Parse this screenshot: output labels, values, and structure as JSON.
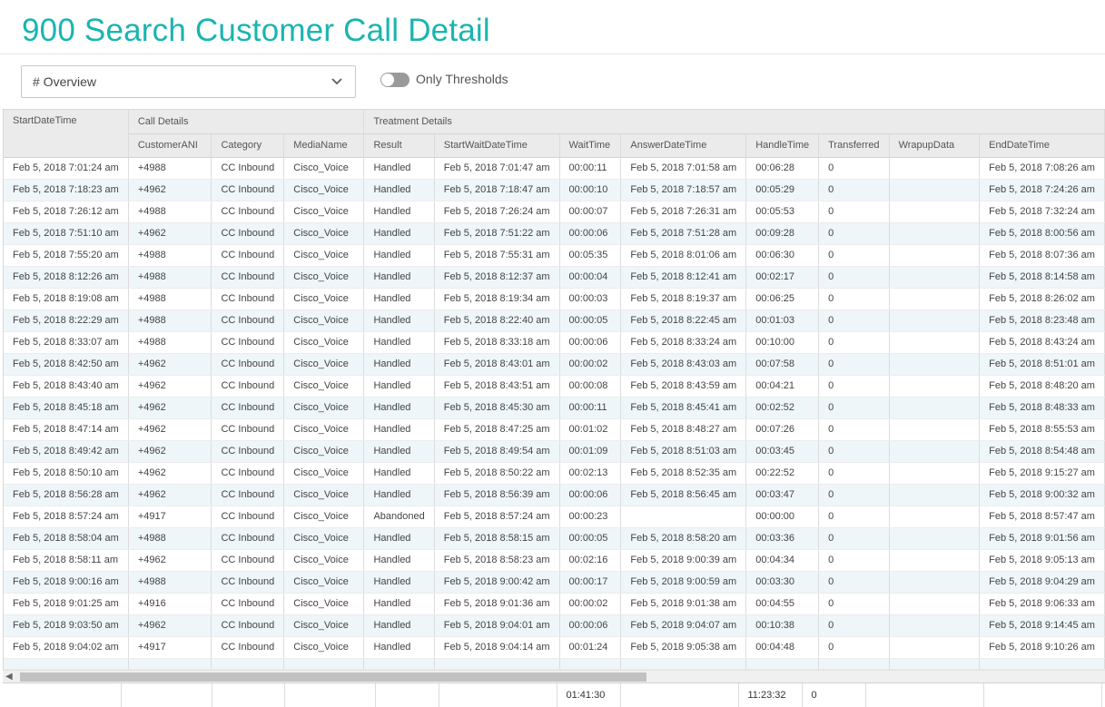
{
  "page": {
    "title": "900 Search Customer Call Detail"
  },
  "toolbar": {
    "view_select": "# Overview",
    "toggle_label": "Only Thresholds",
    "toggle_on": false
  },
  "grid": {
    "groups": {
      "start": "StartDateTime",
      "call": "Call Details",
      "treatment": "Treatment Details"
    },
    "columns": [
      "CustomerANI",
      "Category",
      "MediaName",
      "Result",
      "StartWaitDateTime",
      "WaitTime",
      "AnswerDateTime",
      "HandleTime",
      "Transferred",
      "WrapupData",
      "EndDateTime"
    ],
    "rows": [
      [
        "Feb 5, 2018 7:01:24 am",
        "+4988",
        "CC Inbound",
        "Cisco_Voice",
        "Handled",
        "Feb 5, 2018 7:01:47 am",
        "00:00:11",
        "Feb 5, 2018 7:01:58 am",
        "00:06:28",
        "0",
        "",
        "Feb 5, 2018 7:08:26 am"
      ],
      [
        "Feb 5, 2018 7:18:23 am",
        "+4962",
        "CC Inbound",
        "Cisco_Voice",
        "Handled",
        "Feb 5, 2018 7:18:47 am",
        "00:00:10",
        "Feb 5, 2018 7:18:57 am",
        "00:05:29",
        "0",
        "",
        "Feb 5, 2018 7:24:26 am"
      ],
      [
        "Feb 5, 2018 7:26:12 am",
        "+4988",
        "CC Inbound",
        "Cisco_Voice",
        "Handled",
        "Feb 5, 2018 7:26:24 am",
        "00:00:07",
        "Feb 5, 2018 7:26:31 am",
        "00:05:53",
        "0",
        "",
        "Feb 5, 2018 7:32:24 am"
      ],
      [
        "Feb 5, 2018 7:51:10 am",
        "+4962",
        "CC Inbound",
        "Cisco_Voice",
        "Handled",
        "Feb 5, 2018 7:51:22 am",
        "00:00:06",
        "Feb 5, 2018 7:51:28 am",
        "00:09:28",
        "0",
        "",
        "Feb 5, 2018 8:00:56 am"
      ],
      [
        "Feb 5, 2018 7:55:20 am",
        "+4988",
        "CC Inbound",
        "Cisco_Voice",
        "Handled",
        "Feb 5, 2018 7:55:31 am",
        "00:05:35",
        "Feb 5, 2018 8:01:06 am",
        "00:06:30",
        "0",
        "",
        "Feb 5, 2018 8:07:36 am"
      ],
      [
        "Feb 5, 2018 8:12:26 am",
        "+4988",
        "CC Inbound",
        "Cisco_Voice",
        "Handled",
        "Feb 5, 2018 8:12:37 am",
        "00:00:04",
        "Feb 5, 2018 8:12:41 am",
        "00:02:17",
        "0",
        "",
        "Feb 5, 2018 8:14:58 am"
      ],
      [
        "Feb 5, 2018 8:19:08 am",
        "+4988",
        "CC Inbound",
        "Cisco_Voice",
        "Handled",
        "Feb 5, 2018 8:19:34 am",
        "00:00:03",
        "Feb 5, 2018 8:19:37 am",
        "00:06:25",
        "0",
        "",
        "Feb 5, 2018 8:26:02 am"
      ],
      [
        "Feb 5, 2018 8:22:29 am",
        "+4988",
        "CC Inbound",
        "Cisco_Voice",
        "Handled",
        "Feb 5, 2018 8:22:40 am",
        "00:00:05",
        "Feb 5, 2018 8:22:45 am",
        "00:01:03",
        "0",
        "",
        "Feb 5, 2018 8:23:48 am"
      ],
      [
        "Feb 5, 2018 8:33:07 am",
        "+4988",
        "CC Inbound",
        "Cisco_Voice",
        "Handled",
        "Feb 5, 2018 8:33:18 am",
        "00:00:06",
        "Feb 5, 2018 8:33:24 am",
        "00:10:00",
        "0",
        "",
        "Feb 5, 2018 8:43:24 am"
      ],
      [
        "Feb 5, 2018 8:42:50 am",
        "+4962",
        "CC Inbound",
        "Cisco_Voice",
        "Handled",
        "Feb 5, 2018 8:43:01 am",
        "00:00:02",
        "Feb 5, 2018 8:43:03 am",
        "00:07:58",
        "0",
        "",
        "Feb 5, 2018 8:51:01 am"
      ],
      [
        "Feb 5, 2018 8:43:40 am",
        "+4962",
        "CC Inbound",
        "Cisco_Voice",
        "Handled",
        "Feb 5, 2018 8:43:51 am",
        "00:00:08",
        "Feb 5, 2018 8:43:59 am",
        "00:04:21",
        "0",
        "",
        "Feb 5, 2018 8:48:20 am"
      ],
      [
        "Feb 5, 2018 8:45:18 am",
        "+4962",
        "CC Inbound",
        "Cisco_Voice",
        "Handled",
        "Feb 5, 2018 8:45:30 am",
        "00:00:11",
        "Feb 5, 2018 8:45:41 am",
        "00:02:52",
        "0",
        "",
        "Feb 5, 2018 8:48:33 am"
      ],
      [
        "Feb 5, 2018 8:47:14 am",
        "+4962",
        "CC Inbound",
        "Cisco_Voice",
        "Handled",
        "Feb 5, 2018 8:47:25 am",
        "00:01:02",
        "Feb 5, 2018 8:48:27 am",
        "00:07:26",
        "0",
        "",
        "Feb 5, 2018 8:55:53 am"
      ],
      [
        "Feb 5, 2018 8:49:42 am",
        "+4962",
        "CC Inbound",
        "Cisco_Voice",
        "Handled",
        "Feb 5, 2018 8:49:54 am",
        "00:01:09",
        "Feb 5, 2018 8:51:03 am",
        "00:03:45",
        "0",
        "",
        "Feb 5, 2018 8:54:48 am"
      ],
      [
        "Feb 5, 2018 8:50:10 am",
        "+4962",
        "CC Inbound",
        "Cisco_Voice",
        "Handled",
        "Feb 5, 2018 8:50:22 am",
        "00:02:13",
        "Feb 5, 2018 8:52:35 am",
        "00:22:52",
        "0",
        "",
        "Feb 5, 2018 9:15:27 am"
      ],
      [
        "Feb 5, 2018 8:56:28 am",
        "+4962",
        "CC Inbound",
        "Cisco_Voice",
        "Handled",
        "Feb 5, 2018 8:56:39 am",
        "00:00:06",
        "Feb 5, 2018 8:56:45 am",
        "00:03:47",
        "0",
        "",
        "Feb 5, 2018 9:00:32 am"
      ],
      [
        "Feb 5, 2018 8:57:24 am",
        "+4917",
        "CC Inbound",
        "Cisco_Voice",
        "Abandoned",
        "Feb 5, 2018 8:57:24 am",
        "00:00:23",
        "",
        "00:00:00",
        "0",
        "",
        "Feb 5, 2018 8:57:47 am"
      ],
      [
        "Feb 5, 2018 8:58:04 am",
        "+4988",
        "CC Inbound",
        "Cisco_Voice",
        "Handled",
        "Feb 5, 2018 8:58:15 am",
        "00:00:05",
        "Feb 5, 2018 8:58:20 am",
        "00:03:36",
        "0",
        "",
        "Feb 5, 2018 9:01:56 am"
      ],
      [
        "Feb 5, 2018 8:58:11 am",
        "+4962",
        "CC Inbound",
        "Cisco_Voice",
        "Handled",
        "Feb 5, 2018 8:58:23 am",
        "00:02:16",
        "Feb 5, 2018 9:00:39 am",
        "00:04:34",
        "0",
        "",
        "Feb 5, 2018 9:05:13 am"
      ],
      [
        "Feb 5, 2018 9:00:16 am",
        "+4988",
        "CC Inbound",
        "Cisco_Voice",
        "Handled",
        "Feb 5, 2018 9:00:42 am",
        "00:00:17",
        "Feb 5, 2018 9:00:59 am",
        "00:03:30",
        "0",
        "",
        "Feb 5, 2018 9:04:29 am"
      ],
      [
        "Feb 5, 2018 9:01:25 am",
        "+4916",
        "CC Inbound",
        "Cisco_Voice",
        "Handled",
        "Feb 5, 2018 9:01:36 am",
        "00:00:02",
        "Feb 5, 2018 9:01:38 am",
        "00:04:55",
        "0",
        "",
        "Feb 5, 2018 9:06:33 am"
      ],
      [
        "Feb 5, 2018 9:03:50 am",
        "+4962",
        "CC Inbound",
        "Cisco_Voice",
        "Handled",
        "Feb 5, 2018 9:04:01 am",
        "00:00:06",
        "Feb 5, 2018 9:04:07 am",
        "00:10:38",
        "0",
        "",
        "Feb 5, 2018 9:14:45 am"
      ],
      [
        "Feb 5, 2018 9:04:02 am",
        "+4917",
        "CC Inbound",
        "Cisco_Voice",
        "Handled",
        "Feb 5, 2018 9:04:14 am",
        "00:01:24",
        "Feb 5, 2018 9:05:38 am",
        "00:04:48",
        "0",
        "",
        "Feb 5, 2018 9:10:26 am"
      ]
    ],
    "footer": [
      "",
      "",
      "",
      "",
      "",
      "",
      "01:41:30",
      "",
      "11:23:32",
      "0",
      "",
      ""
    ]
  },
  "colors": {
    "title": "#1ab5b0",
    "header_bg": "#ebebeb",
    "row_alt": "#eef6f9"
  }
}
